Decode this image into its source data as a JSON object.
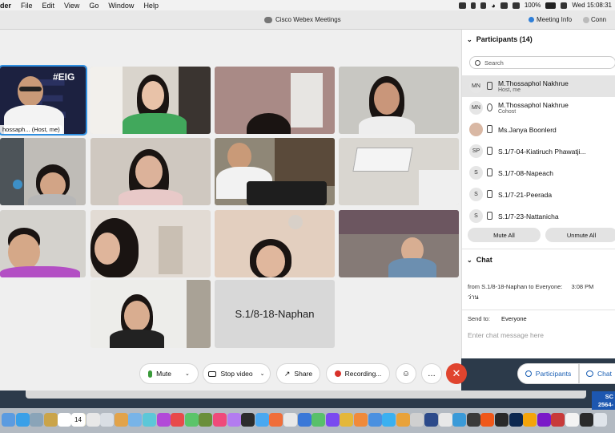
{
  "menubar": {
    "app_name": "der",
    "items": [
      "File",
      "Edit",
      "View",
      "Go",
      "Window",
      "Help"
    ],
    "battery": "100%",
    "clock": "Wed 15:08:31"
  },
  "window": {
    "title": "Cisco Webex Meetings",
    "meeting_info": "Meeting Info",
    "conn": "Conn"
  },
  "grid": {
    "host_label": "hossaph... (Host, me)",
    "host_badge": "#EIG",
    "name_tile": "S.1/8-18-Naphan"
  },
  "controls": {
    "mute": "Mute",
    "stop_video": "Stop video",
    "share": "Share",
    "recording": "Recording...",
    "more": "…",
    "participants": "Participants",
    "chat": "Chat"
  },
  "participants": {
    "heading": "Participants (14)",
    "search_placeholder": "Search",
    "list": [
      {
        "initials": "MN",
        "name": "M.Thossaphol Nakhrue",
        "sub": "Host, me"
      },
      {
        "initials": "MN",
        "name": "M.Thossaphol Nakhrue",
        "sub": "Cohost"
      },
      {
        "initials": "",
        "name": "Ms.Janya Boonlerd",
        "sub": ""
      },
      {
        "initials": "SP",
        "name": "S.1/7-04-Kiatiruch Phawatji...",
        "sub": ""
      },
      {
        "initials": "S",
        "name": "S.1/7-08-Napeach",
        "sub": ""
      },
      {
        "initials": "S",
        "name": "S.1/7-21-Peerada",
        "sub": ""
      },
      {
        "initials": "S",
        "name": "S.1/7-23-Nattanicha",
        "sub": ""
      }
    ],
    "mute_all": "Mute All",
    "unmute_all": "Unmute All"
  },
  "chat": {
    "heading": "Chat",
    "from": "from S.1/8-18-Naphan to Everyone:",
    "time": "3:08 PM",
    "message": "ว่าน",
    "send_to_label": "Send to:",
    "send_to_value": "Everyone",
    "input_placeholder": "Enter chat message here"
  },
  "dock": {
    "calendar_day": "14"
  },
  "notice": {
    "line1": "SC",
    "line2": "2564-"
  }
}
